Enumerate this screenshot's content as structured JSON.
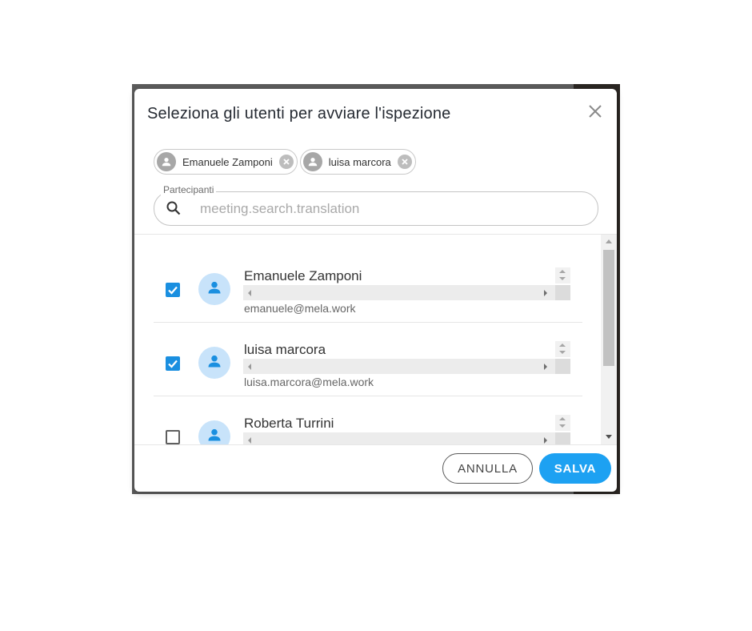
{
  "dialog": {
    "title": "Seleziona gli utenti per avviare l'ispezione",
    "close_icon": "close-icon"
  },
  "chips": [
    {
      "label": "Emanuele Zamponi"
    },
    {
      "label": "luisa marcora"
    }
  ],
  "search": {
    "label": "Partecipanti",
    "placeholder": "meeting.search.translation",
    "value": ""
  },
  "users": [
    {
      "name": "Emanuele Zamponi",
      "email": "emanuele@mela.work",
      "checked": true
    },
    {
      "name": "luisa marcora",
      "email": "luisa.marcora@mela.work",
      "checked": true
    },
    {
      "name": "Roberta Turrini",
      "email": "",
      "checked": false
    }
  ],
  "footer": {
    "cancel_label": "ANNULLA",
    "save_label": "SALVA"
  },
  "colors": {
    "accent": "#1da1f2",
    "checkbox": "#1a8fe0",
    "avatar_bg": "#c8e3fa",
    "avatar_icon": "#1a8fe0"
  }
}
